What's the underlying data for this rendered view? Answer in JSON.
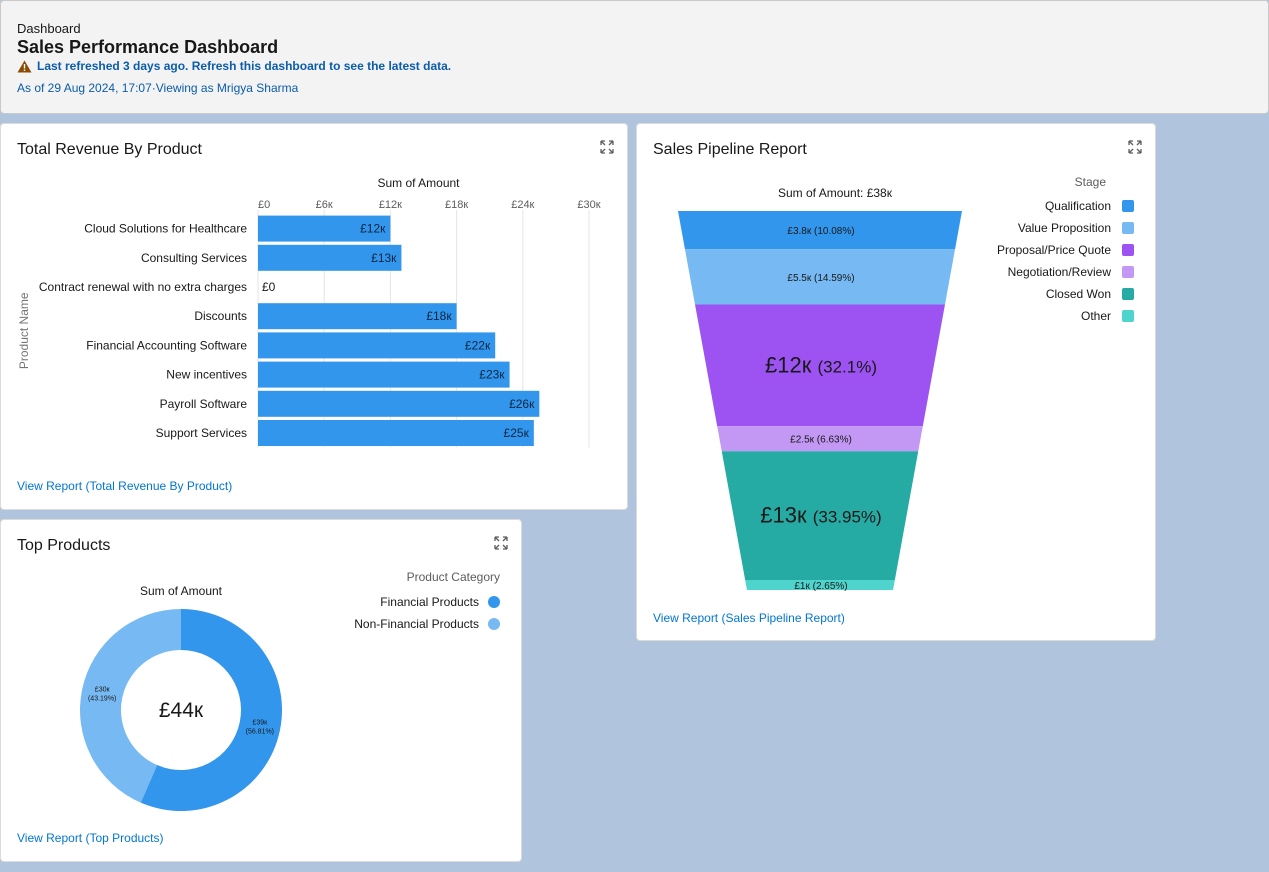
{
  "header": {
    "breadcrumb": "Dashboard",
    "title": "Sales Performance Dashboard",
    "warning": "Last refreshed 3 days ago. Refresh this dashboard to see the latest data.",
    "as_of": "As of 29 Aug 2024, 17:07·Viewing as Mrigya Sharma"
  },
  "colors": {
    "page_bg": "#b0c4de",
    "link": "#0176d3",
    "bar": "#3296ed",
    "warning_icon": "#8c4b02"
  },
  "revenue_card": {
    "title": "Total Revenue By Product",
    "link": "View Report (Total Revenue By Product)",
    "expand_icon": "expand-icon"
  },
  "pipeline_card": {
    "title": "Sales Pipeline Report",
    "link": "View Report (Sales Pipeline Report)",
    "expand_icon": "expand-icon"
  },
  "top_products_card": {
    "title": "Top Products",
    "link": "View Report (Top Products)",
    "expand_icon": "expand-icon"
  },
  "chart_data": [
    {
      "type": "bar",
      "orientation": "horizontal",
      "title": "Sum of Amount",
      "ylabel": "Product Name",
      "xlim": [
        0,
        30
      ],
      "x_ticks": [
        "£0",
        "£6к",
        "£12к",
        "£18к",
        "£24к",
        "£30к"
      ],
      "categories": [
        "Cloud Solutions for Healthcare",
        "Consulting Services",
        "Contract renewal with no extra charges",
        "Discounts",
        "Financial Accounting Software",
        "New incentives",
        "Payroll Software",
        "Support Services"
      ],
      "values": [
        12,
        13,
        0,
        18,
        21.5,
        22.8,
        25.5,
        25
      ],
      "data_labels": [
        "£12к",
        "£13к",
        "£0",
        "£18к",
        "£22к",
        "£23к",
        "£26к",
        "£25к"
      ],
      "grid": true
    },
    {
      "type": "funnel",
      "title": "Sum of Amount: £38к",
      "legend_title": "Stage",
      "legend_position": "right",
      "stages": [
        {
          "name": "Qualification",
          "value": 3.8,
          "percent": 10.08,
          "label_value": "£3.8к",
          "label_pct": "(10.08%)",
          "color": "#3296ed"
        },
        {
          "name": "Value Proposition",
          "value": 5.5,
          "percent": 14.59,
          "label_value": "£5.5к",
          "label_pct": "(14.59%)",
          "color": "#77b9f2"
        },
        {
          "name": "Proposal/Price Quote",
          "value": 12,
          "percent": 32.1,
          "label_value": "£12к",
          "label_pct": "(32.1%)",
          "color": "#9d53f2"
        },
        {
          "name": "Negotiation/Review",
          "value": 2.5,
          "percent": 6.63,
          "label_value": "£2.5к",
          "label_pct": "(6.63%)",
          "color": "#c398f5"
        },
        {
          "name": "Closed Won",
          "value": 13,
          "percent": 33.95,
          "label_value": "£13к",
          "label_pct": "(33.95%)",
          "color": "#26aba4"
        },
        {
          "name": "Other",
          "value": 1,
          "percent": 2.65,
          "label_value": "£1к",
          "label_pct": "(2.65%)",
          "color": "#4ed4cd"
        }
      ]
    },
    {
      "type": "donut",
      "title": "Sum of Amount",
      "center_label": "£44к",
      "legend_title": "Product Category",
      "legend_position": "right",
      "slices": [
        {
          "name": "Financial Products",
          "value": 39,
          "percent": 56.81,
          "label_value": "£39к",
          "label_pct": "(56.81%)",
          "color": "#3296ed"
        },
        {
          "name": "Non-Financial Products",
          "value": 30,
          "percent": 43.19,
          "label_value": "£30к",
          "label_pct": "(43.19%)",
          "color": "#77b9f2"
        }
      ]
    }
  ]
}
